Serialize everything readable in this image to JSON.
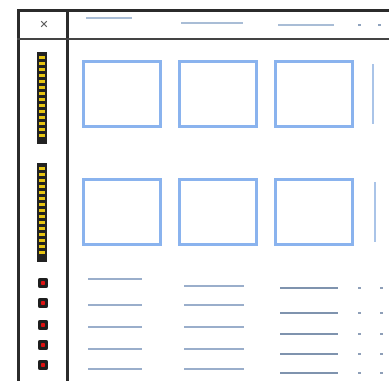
{
  "toolbar": {
    "close_glyph": "✕"
  },
  "icons": {
    "close": "close-icon"
  },
  "colors": {
    "frame": "#2b2b2b",
    "thumbnail_border": "#8ab3ee",
    "strip_fill": "#e6c412",
    "led": "#dd1111",
    "placeholder_line": "#9aaecb"
  },
  "grid": {
    "rows": 2,
    "columns": 4,
    "visible_columns": 3
  },
  "list": {
    "rows": 5
  }
}
